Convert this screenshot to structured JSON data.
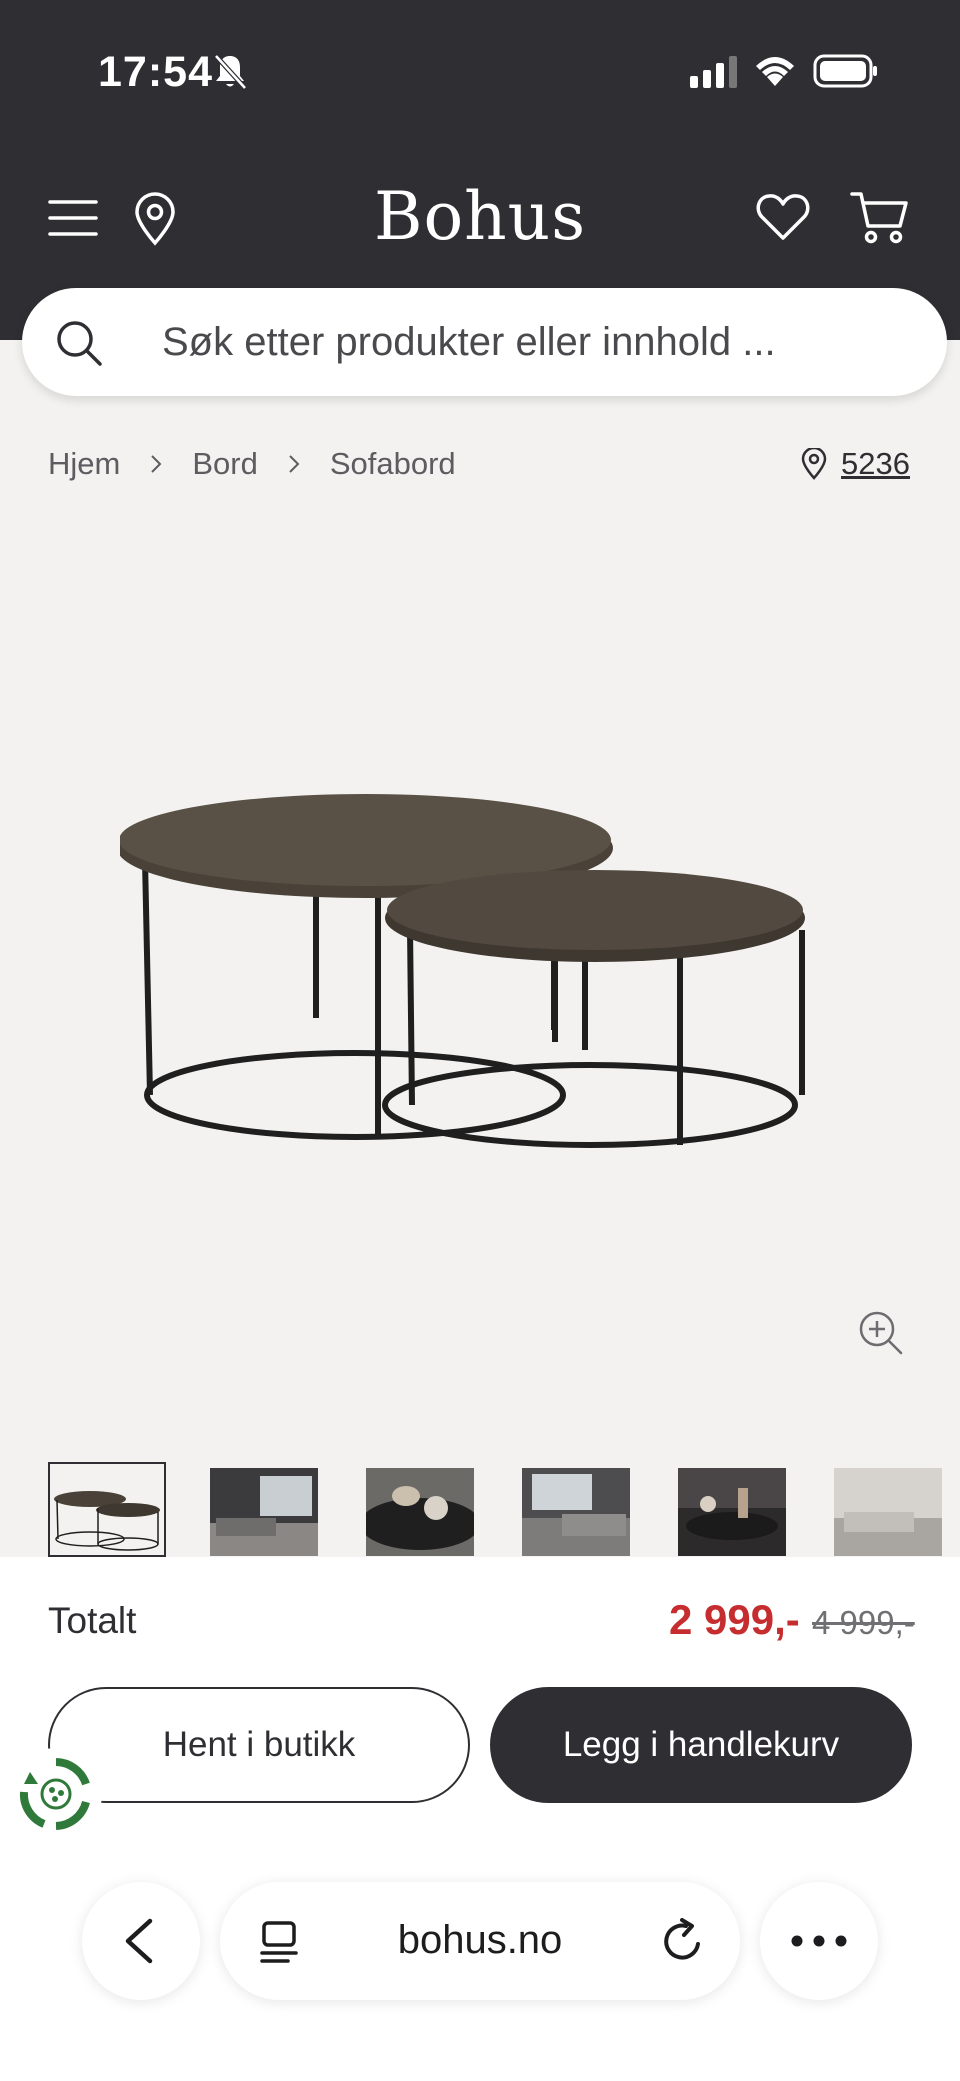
{
  "status_bar": {
    "time": "17:54"
  },
  "header": {
    "brand": "Bohus"
  },
  "search": {
    "placeholder": "Søk etter produkter eller innhold ..."
  },
  "breadcrumb": {
    "items": [
      "Hjem",
      "Bord",
      "Sofabord"
    ],
    "store_number": "5236"
  },
  "product": {
    "thumbnail_count": 6,
    "total_label": "Totalt",
    "price": "2 999,-",
    "old_price": "4 999,-",
    "pickup_label": "Hent i butikk",
    "add_to_cart_label": "Legg i handlekurv"
  },
  "browser": {
    "url": "bohus.no"
  },
  "colors": {
    "header_bg": "#2f2e33",
    "page_bg": "#f3f2f0",
    "sale_price": "#c62d2f",
    "accent_dark": "#2f2e33"
  }
}
